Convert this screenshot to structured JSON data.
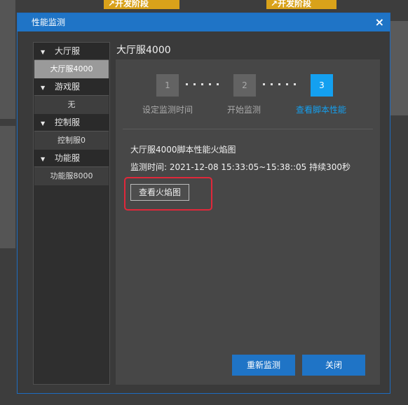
{
  "background": {
    "tag1": "↗开发阶段",
    "tag2": "↗开发阶段"
  },
  "dialog": {
    "title": "性能监测",
    "close_symbol": "×"
  },
  "sidebar": {
    "groups": [
      {
        "label": "大厅服",
        "items": [
          "大厅服4000"
        ]
      },
      {
        "label": "游戏服",
        "items": [
          "无"
        ]
      },
      {
        "label": "控制服",
        "items": [
          "控制服0"
        ]
      },
      {
        "label": "功能服",
        "items": [
          "功能服8000"
        ]
      }
    ]
  },
  "main": {
    "title": "大厅服4000",
    "steps": [
      {
        "num": "1",
        "label": "设定监测时间"
      },
      {
        "num": "2",
        "label": "开始监测"
      },
      {
        "num": "3",
        "label": "查看脚本性能"
      }
    ],
    "info_title": "大厅服4000脚本性能火焰图",
    "info_time": "监测时间: 2021-12-08 15:33:05~15:38::05 持续300秒",
    "flame_button": "查看火焰图"
  },
  "buttons": {
    "restart": "重新监测",
    "close": "关闭"
  },
  "colors": {
    "accent": "#1f74c6",
    "step_active": "#14a0f0",
    "highlight": "#e0283a"
  }
}
